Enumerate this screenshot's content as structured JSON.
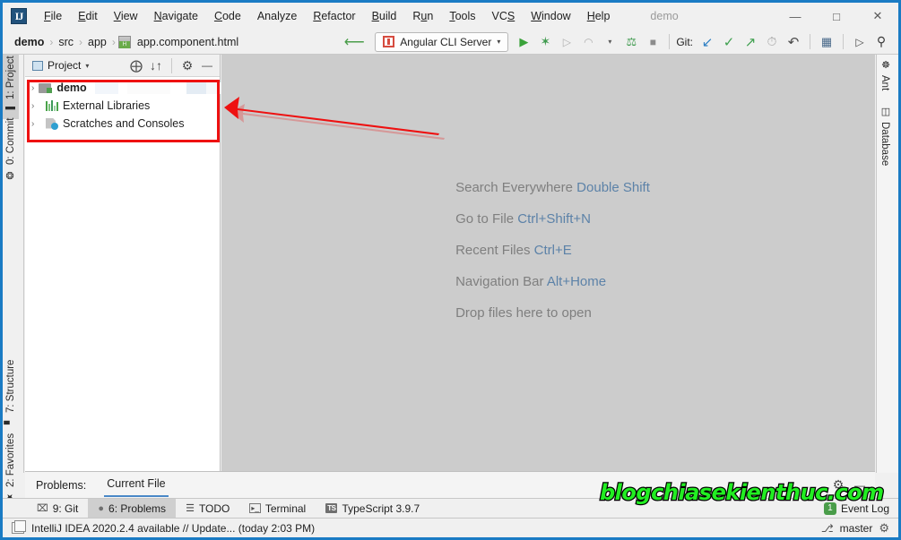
{
  "window": {
    "title": "demo",
    "minimize_label": "—",
    "maximize_label": "□",
    "close_label": "✕",
    "logo_text": "IJ"
  },
  "menu": [
    {
      "label": "File",
      "mnemonic": "F"
    },
    {
      "label": "Edit",
      "mnemonic": "E"
    },
    {
      "label": "View",
      "mnemonic": "V"
    },
    {
      "label": "Navigate",
      "mnemonic": "N"
    },
    {
      "label": "Code",
      "mnemonic": "C"
    },
    {
      "label": "Analyze",
      "mnemonic": ""
    },
    {
      "label": "Refactor",
      "mnemonic": "R"
    },
    {
      "label": "Build",
      "mnemonic": "B"
    },
    {
      "label": "Run",
      "mnemonic": "u"
    },
    {
      "label": "Tools",
      "mnemonic": "T"
    },
    {
      "label": "VCS",
      "mnemonic": "S"
    },
    {
      "label": "Window",
      "mnemonic": "W"
    },
    {
      "label": "Help",
      "mnemonic": "H"
    }
  ],
  "navbar": {
    "breadcrumbs": [
      "demo",
      "src",
      "app",
      "app.component.html"
    ],
    "separator": "›",
    "file_icon": "html-file-icon",
    "run_config": {
      "label": "Angular CLI Server",
      "icon": "angular-icon",
      "caret": "▾"
    },
    "git_label": "Git:",
    "buttons": [
      {
        "name": "run-button",
        "glyph": "▶",
        "color": "#3aa23a"
      },
      {
        "name": "debug-button",
        "glyph": "✶",
        "color": "#3f9a4e"
      },
      {
        "name": "run-with-coverage-button",
        "glyph": "▶",
        "color": "#a8a8a8"
      },
      {
        "name": "profile-button",
        "glyph": "▶",
        "color": "#a8a8a8"
      },
      {
        "name": "attach-debugger-button",
        "glyph": "⚑",
        "color": "#3f9a4e"
      },
      {
        "name": "stop-button",
        "glyph": "■",
        "color": "#8c8c8c"
      },
      {
        "name": "git-update-project-button",
        "glyph": "↙",
        "color": "#2e7fc4"
      },
      {
        "name": "git-commit-button",
        "glyph": "✓",
        "color": "#3fa04f"
      },
      {
        "name": "git-push-button",
        "glyph": "↗",
        "color": "#3fa04f"
      },
      {
        "name": "git-history-button",
        "glyph": "◴",
        "color": "#9a9a9a"
      },
      {
        "name": "git-rollback-button",
        "glyph": "↶",
        "color": "#4a4a4a"
      },
      {
        "name": "project-structure-button",
        "glyph": "▤",
        "color": "#4a6a8a"
      },
      {
        "name": "updates-button",
        "glyph": "▷",
        "color": "#4a4a4a"
      },
      {
        "name": "search-everywhere-button",
        "glyph": "⚲",
        "color": "#3a3a3a"
      }
    ]
  },
  "left_strip": [
    {
      "label": "1: Project",
      "num": "1",
      "rest": ": Project",
      "icon": "■",
      "selected": true
    },
    {
      "label": "0: Commit",
      "num": "0",
      "rest": ": Commit",
      "icon": "⬦",
      "selected": false
    },
    {
      "label": "7: Structure",
      "num": "7",
      "rest": ": Structure",
      "icon": "⠿",
      "selected": false
    },
    {
      "label": "2: Favorites",
      "num": "2",
      "rest": ": Favorites",
      "icon": "★",
      "selected": false
    }
  ],
  "right_strip": [
    {
      "label": "Ant",
      "icon": "ant-icon",
      "glyph": "☸"
    },
    {
      "label": "Database",
      "icon": "database-icon",
      "glyph": "⛃"
    }
  ],
  "project_panel": {
    "title": "Project",
    "title_caret": "▾",
    "tools": [
      {
        "name": "select-opened-file-icon",
        "glyph": "⨁"
      },
      {
        "name": "collapse-all-icon",
        "glyph": "⤓"
      },
      {
        "name": "settings-gear-icon",
        "glyph": "⚙"
      },
      {
        "name": "hide-panel-icon",
        "glyph": "—"
      }
    ],
    "tree": [
      {
        "label": "demo",
        "icon": "module-icon",
        "bold": true,
        "arrow": "›",
        "redacted": true
      },
      {
        "label": "External Libraries",
        "icon": "library-icon",
        "bold": false,
        "arrow": "›",
        "redacted": false
      },
      {
        "label": "Scratches and Consoles",
        "icon": "scratches-icon",
        "bold": false,
        "arrow": "›",
        "redacted": false
      }
    ]
  },
  "editor_hints": [
    {
      "action": "Search Everywhere",
      "shortcut": "Double Shift"
    },
    {
      "action": "Go to File",
      "shortcut": "Ctrl+Shift+N"
    },
    {
      "action": "Recent Files",
      "shortcut": "Ctrl+E"
    },
    {
      "action": "Navigation Bar",
      "shortcut": "Alt+Home"
    },
    {
      "action": "Drop files here to open",
      "shortcut": ""
    }
  ],
  "problems_panel": {
    "label": "Problems:",
    "active_tab": "Current File",
    "tools": [
      {
        "name": "settings-gear-icon",
        "glyph": "⚙"
      },
      {
        "name": "hide-panel-icon",
        "glyph": "—"
      }
    ]
  },
  "bottom_toolwindows": [
    {
      "label": "9: Git",
      "num": "9",
      "rest": ": Git",
      "icon": "branch-icon",
      "glyph": "⎇",
      "selected": false
    },
    {
      "label": "6: Problems",
      "num": "6",
      "rest": ": Problems",
      "icon": "error-icon",
      "glyph": "❗",
      "selected": true
    },
    {
      "label": "TODO",
      "num": "",
      "rest": "TODO",
      "icon": "list-icon",
      "glyph": "☰",
      "selected": false
    },
    {
      "label": "Terminal",
      "num": "",
      "rest": "Terminal",
      "icon": "terminal-icon",
      "glyph": "▸_",
      "selected": false
    },
    {
      "label": "TypeScript 3.9.7",
      "num": "",
      "rest": "TypeScript 3.9.7",
      "icon": "typescript-icon",
      "glyph": "TS",
      "selected": false
    }
  ],
  "event_log": {
    "label": "Event Log",
    "count": "1"
  },
  "statusbar": {
    "message": "IntelliJ IDEA 2020.2.4 available // Update... (today 2:03 PM)",
    "branch": "master",
    "branch_icon": "⎇",
    "settings_icon": "⚙"
  },
  "watermark": "blogchiasekienthuc.com",
  "annotation": {
    "color": "#ee1111",
    "box_target": "project-tree",
    "arrow_direction": "left"
  }
}
